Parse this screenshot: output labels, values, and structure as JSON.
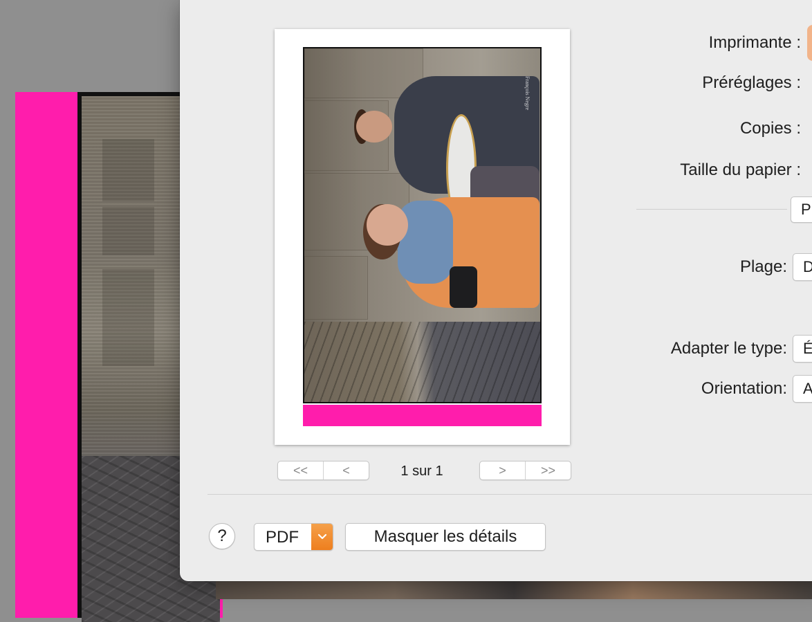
{
  "preview": {
    "watermark": "François Negre",
    "page_counter": "1 sur 1",
    "nav": {
      "first": "<<",
      "prev": "<",
      "next": ">",
      "last": ">>"
    }
  },
  "settings": {
    "printer_label": "Imprimante :",
    "presets_label": "Préréglages :",
    "copies_label": "Copies :",
    "paper_size_label": "Taille du papier :",
    "section_popup_value": "P",
    "range_label": "Plage:",
    "range_value": "D",
    "fit_type_label": "Adapter le type:",
    "fit_type_value": "É",
    "orientation_label": "Orientation:",
    "orientation_value": "A"
  },
  "footer": {
    "help": "?",
    "pdf_label": "PDF",
    "details_button": "Masquer les détails"
  },
  "colors": {
    "accent_pink": "#ff1dac",
    "pdf_orange": "#ee7f1e",
    "printer_popup": "#f2b48a"
  }
}
